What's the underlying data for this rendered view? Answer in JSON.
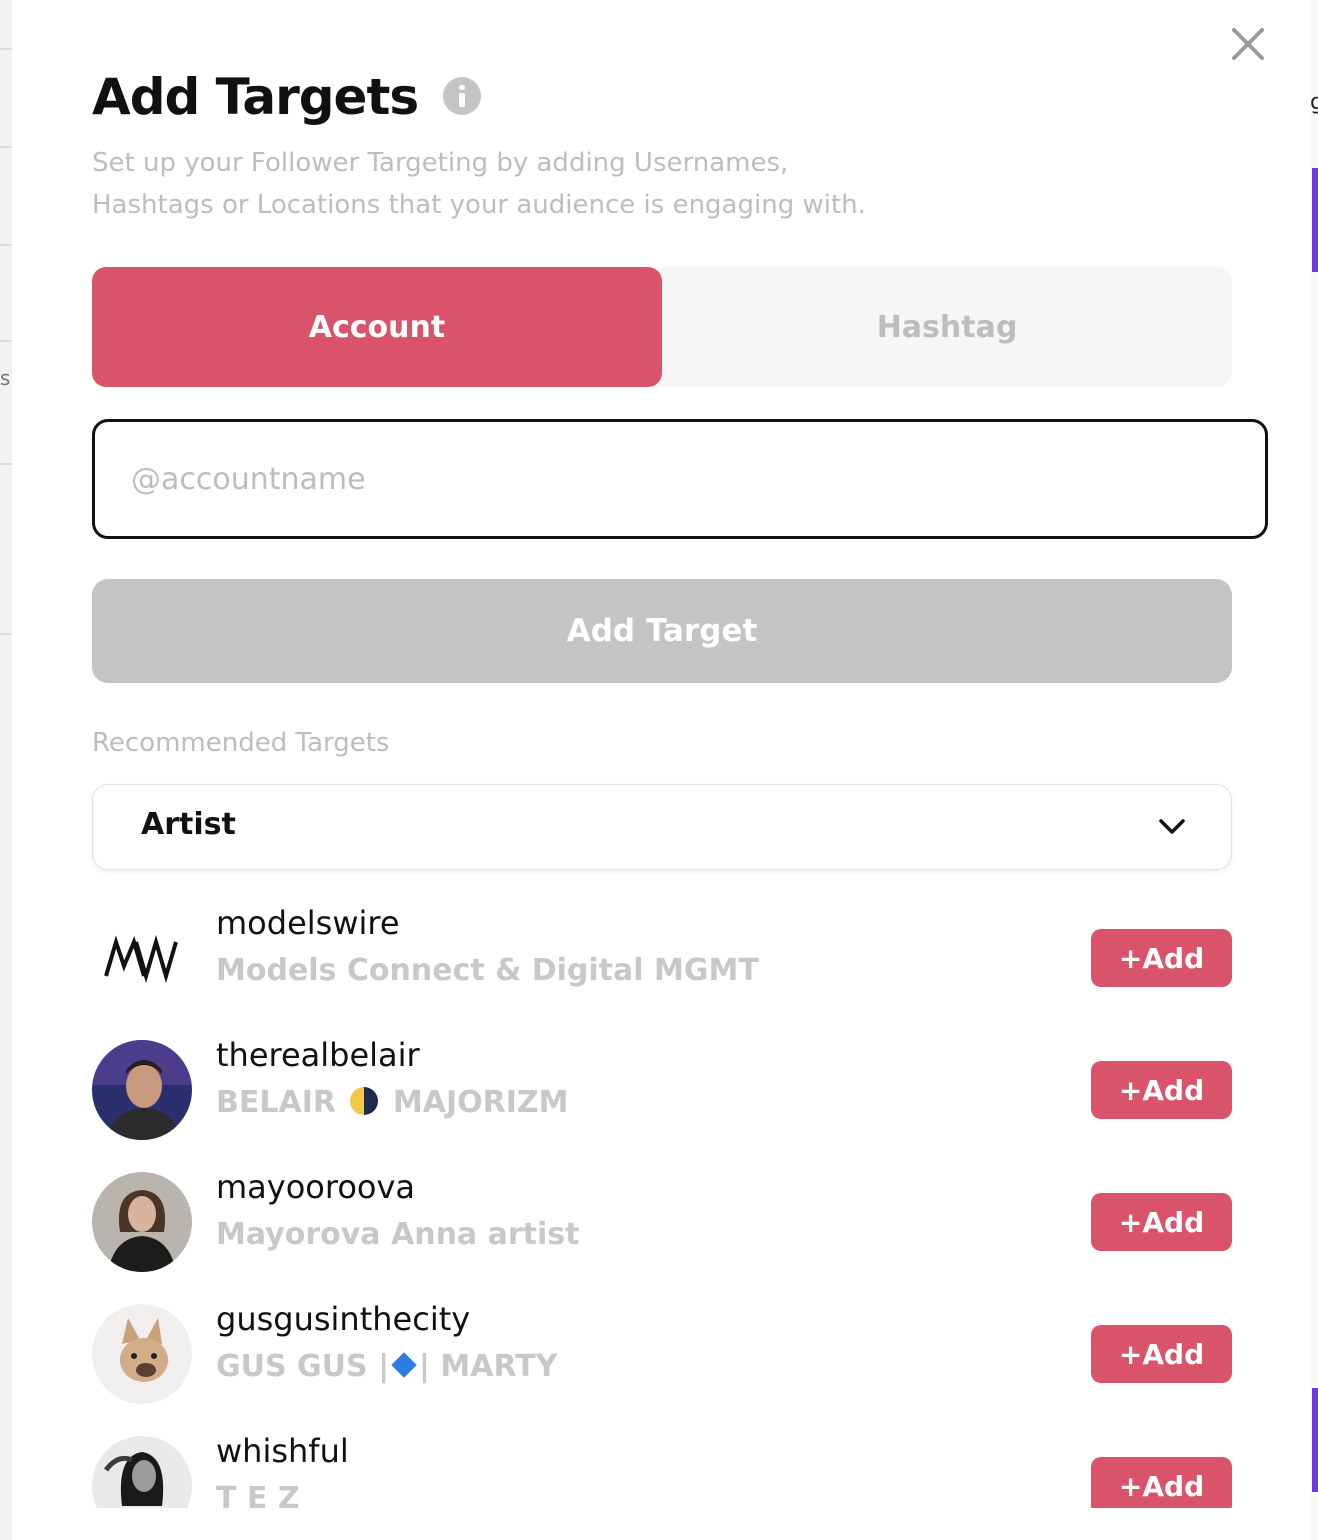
{
  "modal": {
    "title": "Add Targets",
    "subtitle_line1": "Set up your Follower Targeting by adding Usernames,",
    "subtitle_line2": "Hashtags or Locations that your audience is engaging with."
  },
  "tabs": [
    {
      "label": "Account",
      "active": true
    },
    {
      "label": "Hashtag",
      "active": false
    }
  ],
  "input": {
    "placeholder": "@accountname",
    "value": ""
  },
  "add_target_label": "Add Target",
  "recommended": {
    "label": "Recommended Targets",
    "category": "Artist"
  },
  "targets": [
    {
      "username": "modelswire",
      "name": "Models Connect & Digital MGMT",
      "avatar": "modelswire-logo"
    },
    {
      "username": "therealbelair",
      "name_parts": [
        "BELAIR",
        "MAJORIZM"
      ],
      "avatar": "photo"
    },
    {
      "username": "mayooroova",
      "name": "Mayorova Anna artist",
      "avatar": "photo"
    },
    {
      "username": "gusgusinthecity",
      "name_parts": [
        "GUS GUS |",
        "| MARTY"
      ],
      "avatar": "photo"
    },
    {
      "username": "whishful",
      "name": "T E Z",
      "avatar": "photo"
    }
  ],
  "add_button_label": "+Add",
  "colors": {
    "accent": "#d9536b",
    "disabled": "#c4c4c4",
    "muted_text": "#bdbdbd"
  },
  "background_glyphs": {
    "left": "s",
    "right": "g"
  }
}
